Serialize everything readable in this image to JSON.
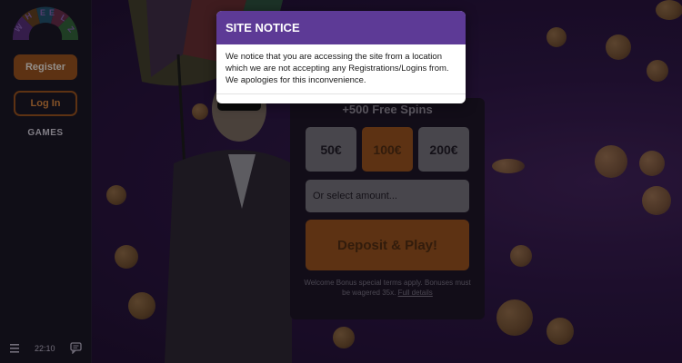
{
  "sidebar": {
    "logo_text": "WHEELZ",
    "register_label": "Register",
    "login_label": "Log In",
    "games_label": "GAMES",
    "clock": "22:10"
  },
  "promo": {
    "free_spins": "+500 Free Spins",
    "amounts": [
      "50€",
      "100€",
      "200€"
    ],
    "selected_amount": "100€",
    "amount_placeholder": "Or select amount...",
    "deposit_label": "Deposit & Play!",
    "terms_text": "Welcome Bonus special terms apply. Bonuses must be wagered 35x.",
    "terms_link": "Full details"
  },
  "modal": {
    "title": "SITE NOTICE",
    "message": "We notice that you are accessing the site from a location which we are not accepting any Registrations/Logins from. We apologies for this inconvenience."
  },
  "colors": {
    "accent_orange": "#8a4a1c",
    "modal_header": "#5d3a96",
    "sidebar_bg": "#181522"
  },
  "icons": [
    "hamburger-menu-icon",
    "chat-icon",
    "wheelz-logo"
  ]
}
